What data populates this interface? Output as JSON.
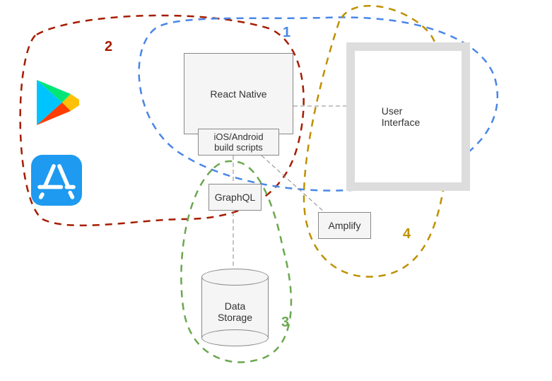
{
  "labels": {
    "region1": "1",
    "region2": "2",
    "region3": "3",
    "region4": "4"
  },
  "nodes": {
    "react_native": "React Native",
    "build_scripts": "iOS/Android\nbuild scripts",
    "graphql": "GraphQL",
    "amplify": "Amplify",
    "user_interface": "User Interface",
    "data_storage": "Data\nStorage"
  },
  "icons": {
    "play_store": "google-play-icon",
    "app_store": "apple-app-store-icon"
  },
  "colors": {
    "region1": "#4a86e8",
    "region2": "#a61c00",
    "region3": "#6aa84f",
    "region4": "#bf9000"
  }
}
